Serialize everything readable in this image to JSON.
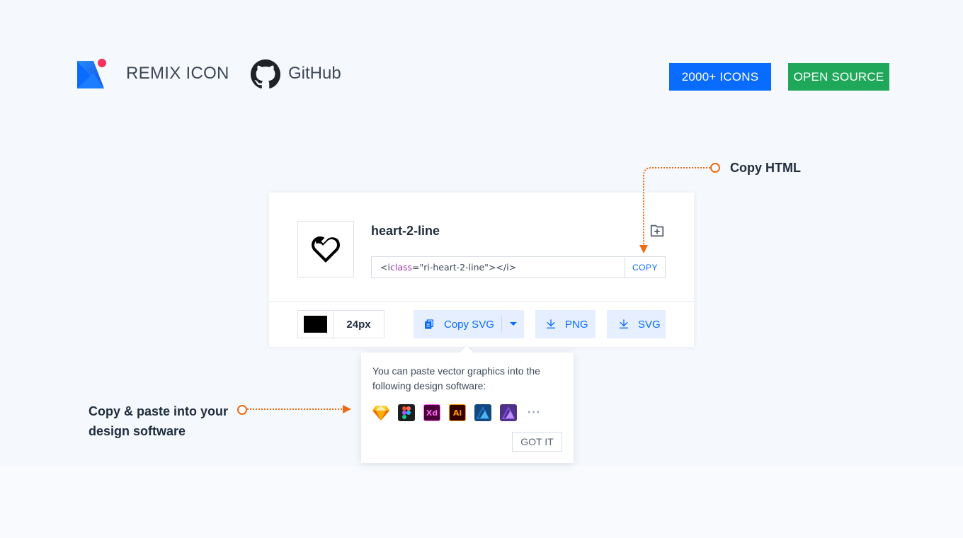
{
  "header": {
    "brand_name": "REMIX ICON",
    "github_label": "GitHub",
    "badge_icons": "2000+ ICONS",
    "badge_open_source": "OPEN SOURCE"
  },
  "card": {
    "icon_name": "heart-2-line",
    "code": {
      "tag_open": "<i ",
      "attr": "class",
      "eq": "=",
      "value": "\"ri-heart-2-line\"",
      "tag_close": "></i>"
    },
    "copy_label": "COPY",
    "color": "#000000",
    "size": "24px",
    "copy_svg_label": "Copy SVG",
    "png_label": "PNG",
    "svg_label": "SVG"
  },
  "popover": {
    "text": "You can paste vector graphics into the following design software:",
    "apps": [
      "sketch-icon",
      "figma-icon",
      "adobe-xd-icon",
      "adobe-illustrator-icon",
      "affinity-designer-icon",
      "affinity-photo-icon"
    ],
    "app_labels": {
      "xd": "Xd",
      "ai": "Ai",
      "more": "···"
    },
    "got_it": "GOT IT"
  },
  "annotations": {
    "copy_html": "Copy HTML",
    "paste_design": "Copy & paste into your design software"
  },
  "colors": {
    "accent": "#0a6cff",
    "green": "#1fa85a",
    "annotation_orange": "#f06a12"
  }
}
